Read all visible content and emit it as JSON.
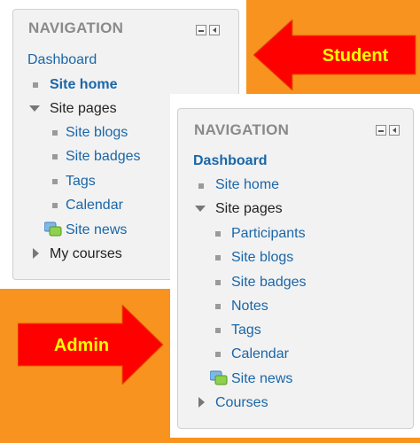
{
  "student_panel": {
    "title": "NAVIGATION",
    "dashboard": "Dashboard",
    "site_home": "Site home",
    "site_pages": "Site pages",
    "site_blogs": "Site blogs",
    "site_badges": "Site badges",
    "tags": "Tags",
    "calendar": "Calendar",
    "site_news": "Site news",
    "my_courses": "My courses"
  },
  "admin_panel": {
    "title": "NAVIGATION",
    "dashboard": "Dashboard",
    "site_home": "Site home",
    "site_pages": "Site pages",
    "participants": "Participants",
    "site_blogs": "Site blogs",
    "site_badges": "Site badges",
    "notes": "Notes",
    "tags": "Tags",
    "calendar": "Calendar",
    "site_news": "Site news",
    "courses": "Courses"
  },
  "labels": {
    "student": "Student",
    "admin": "Admin"
  },
  "colors": {
    "background": "#f7931e",
    "arrow_fill": "#ff0000",
    "arrow_text": "#ffff00",
    "link": "#1a66a8"
  }
}
